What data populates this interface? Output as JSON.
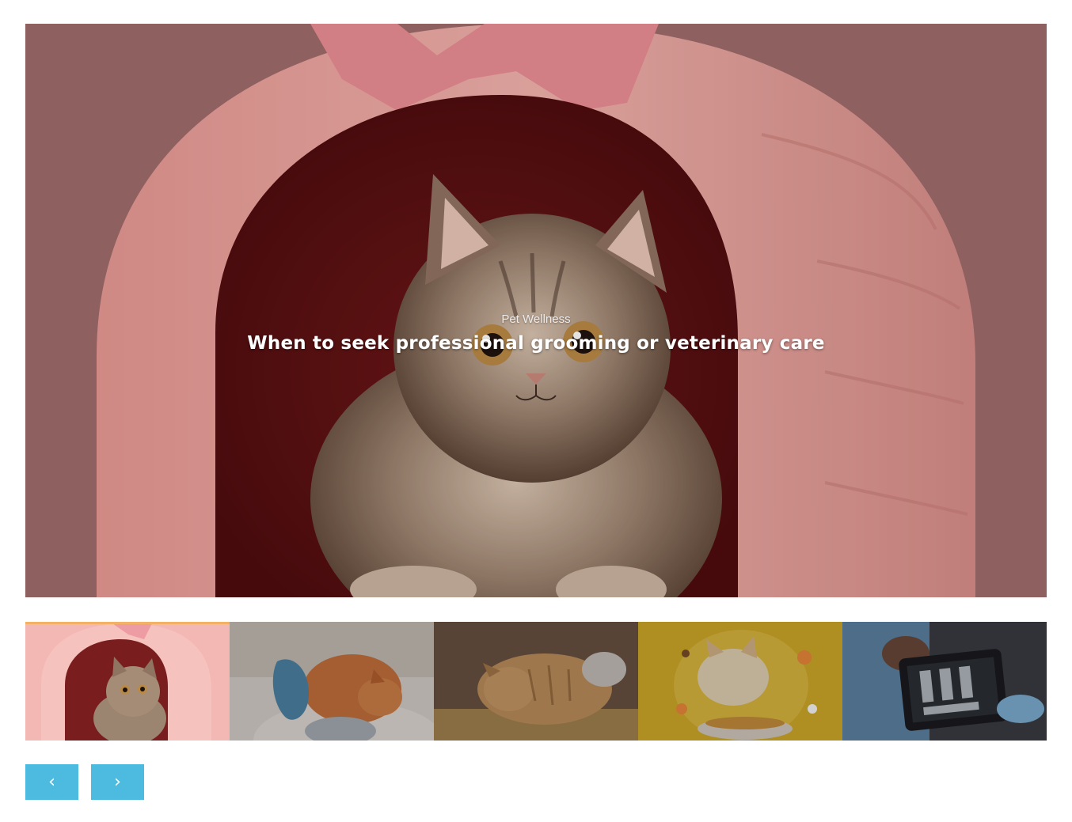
{
  "hero": {
    "category": "Pet Wellness",
    "title": "When to seek professional grooming or veterinary care",
    "image": "cat-in-pink-plush-house"
  },
  "thumbnails": [
    {
      "image": "cat-in-pink-plush-house",
      "active": true
    },
    {
      "image": "ginger-cat-grooming-glove",
      "active": false
    },
    {
      "image": "tabby-cat-sleeping-on-rug",
      "active": false
    },
    {
      "image": "dog-eating-from-bowl-yellow",
      "active": false
    },
    {
      "image": "vet-viewing-xray-tablet",
      "active": false
    }
  ],
  "nav": {
    "prev_icon": "‹",
    "next_icon": "›"
  },
  "colors": {
    "accent": "#4dbbe0",
    "active_thumb_bar": "#f2b165"
  }
}
